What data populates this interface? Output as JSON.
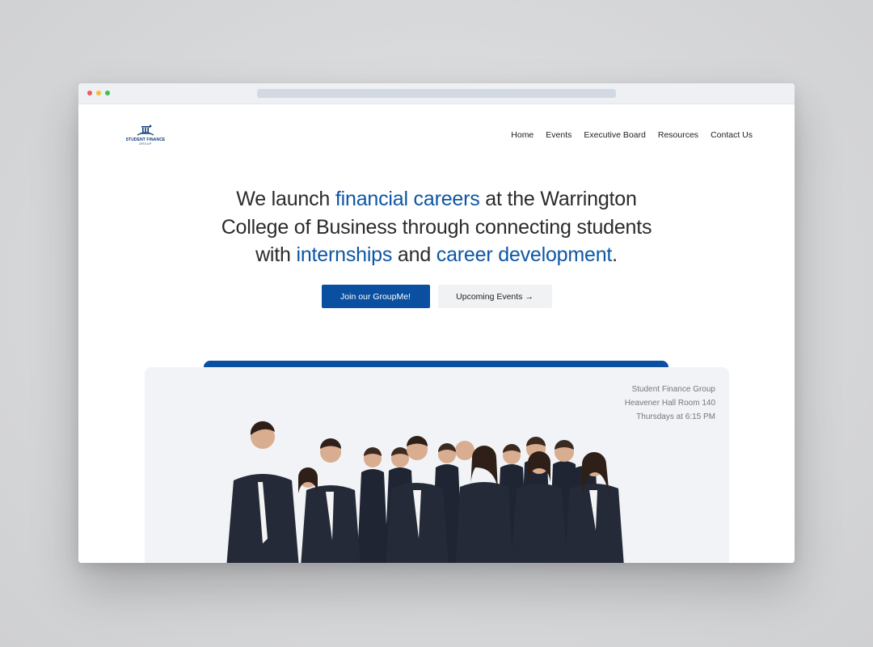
{
  "logo": {
    "text": "STUDENT FINANCE",
    "sub": "GROUP"
  },
  "nav": {
    "items": [
      "Home",
      "Events",
      "Executive Board",
      "Resources",
      "Contact Us"
    ]
  },
  "hero": {
    "line1_a": "We launch ",
    "line1_hl": "financial careers",
    "line1_b": " at the Warrington",
    "line2": "College of Business through connecting students",
    "line3_a": "with ",
    "line3_hl1": "internships",
    "line3_b": " and ",
    "line3_hl2": "career development",
    "line3_c": "."
  },
  "buttons": {
    "primary": "Join our GroupMe!",
    "secondary": "Upcoming Events →"
  },
  "meeting": {
    "name": "Student Finance Group",
    "location": "Heavener Hall Room 140",
    "time": "Thursdays at 6:15 PM"
  },
  "colors": {
    "brand_blue": "#0b4fa0",
    "highlight_blue": "#0d56a4",
    "text": "#2b2b2b"
  }
}
